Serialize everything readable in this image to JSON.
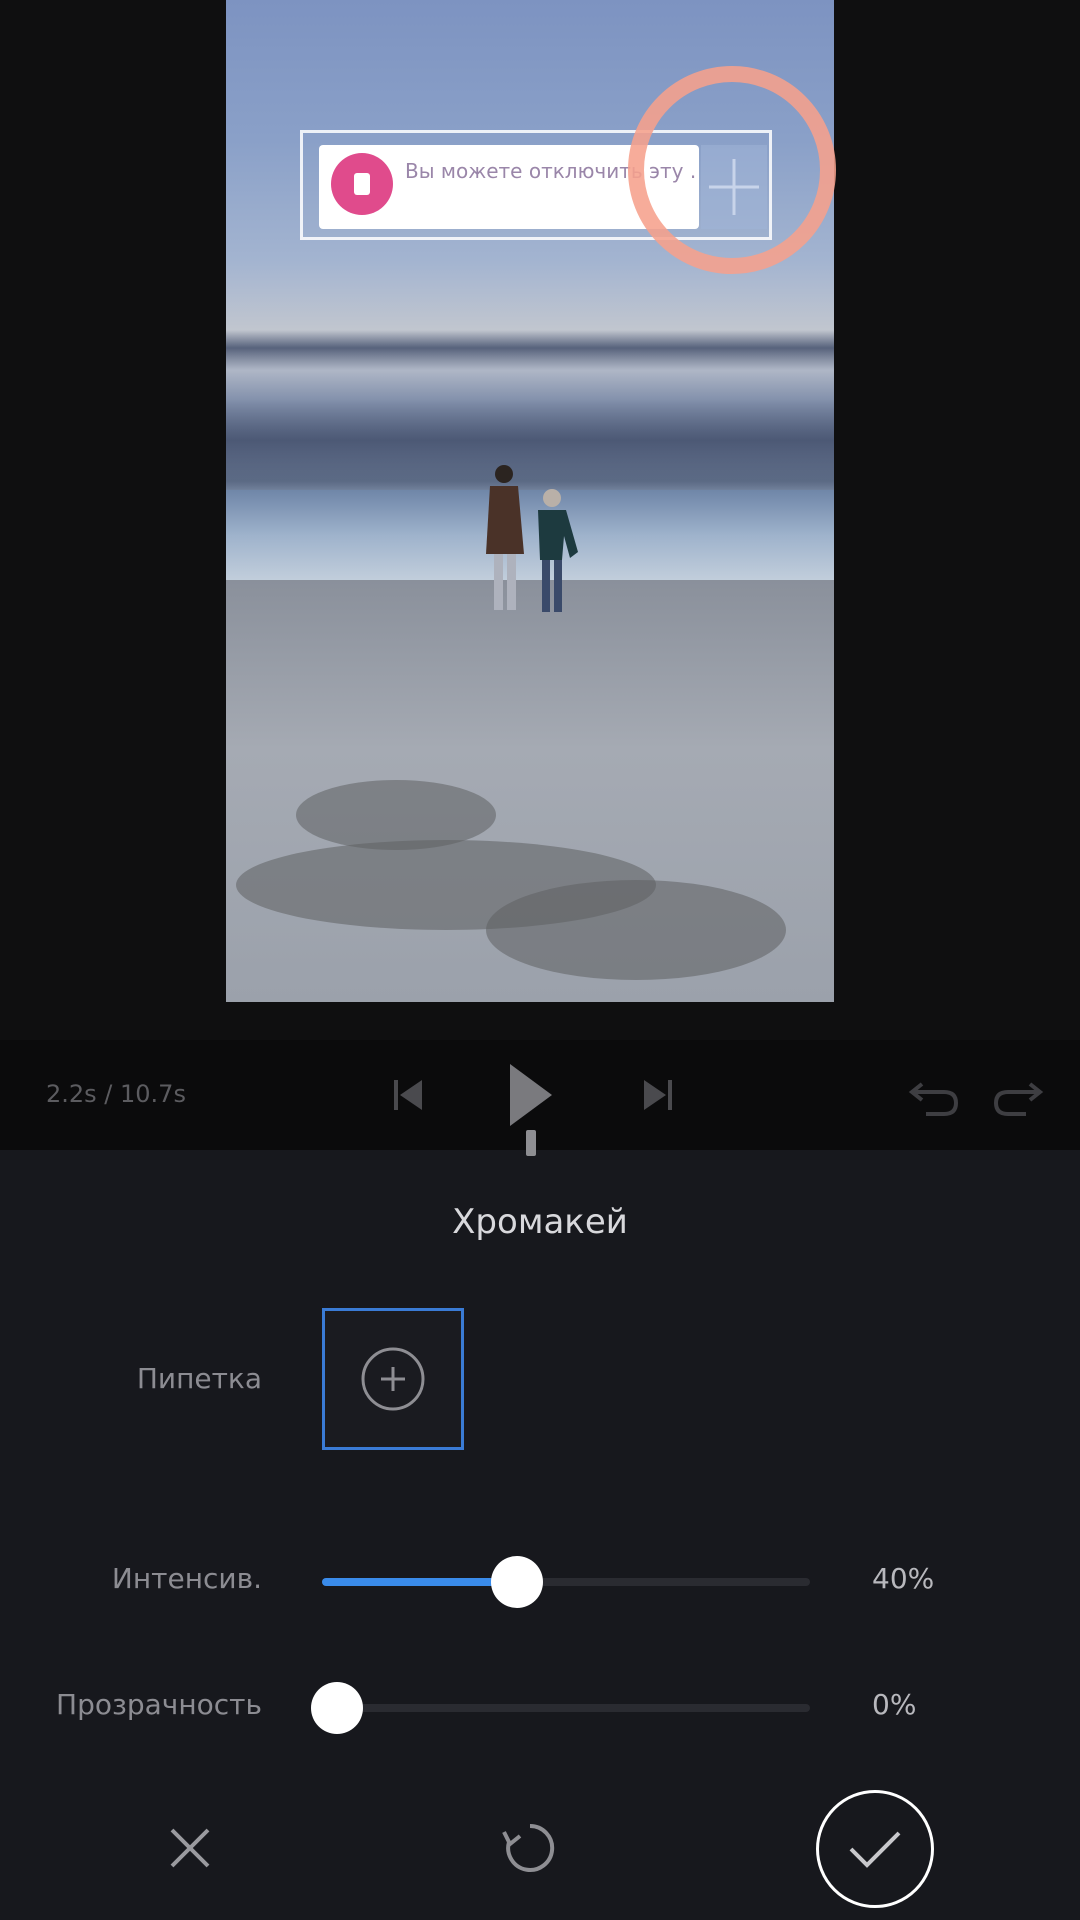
{
  "preview": {
    "sticker_text": "Вы можете отключить эту ..."
  },
  "playback": {
    "time": "2.2s / 10.7s"
  },
  "panel": {
    "title": "Хромакей",
    "eyedropper_label": "Пипетка",
    "intensity": {
      "label": "Интенсив.",
      "value_text": "40%",
      "value": 40
    },
    "shadow": {
      "label": "Прозрачность",
      "value_text": "0%",
      "value": 0
    }
  },
  "colors": {
    "accent": "#3a8bea",
    "highlight_ring": "#f6a08c",
    "panel_bg": "#17181d"
  },
  "icons": [
    "skip-back-icon",
    "play-icon",
    "skip-forward-icon",
    "undo-icon",
    "redo-icon",
    "eyedropper-icon",
    "close-icon",
    "reset-icon",
    "check-icon"
  ]
}
